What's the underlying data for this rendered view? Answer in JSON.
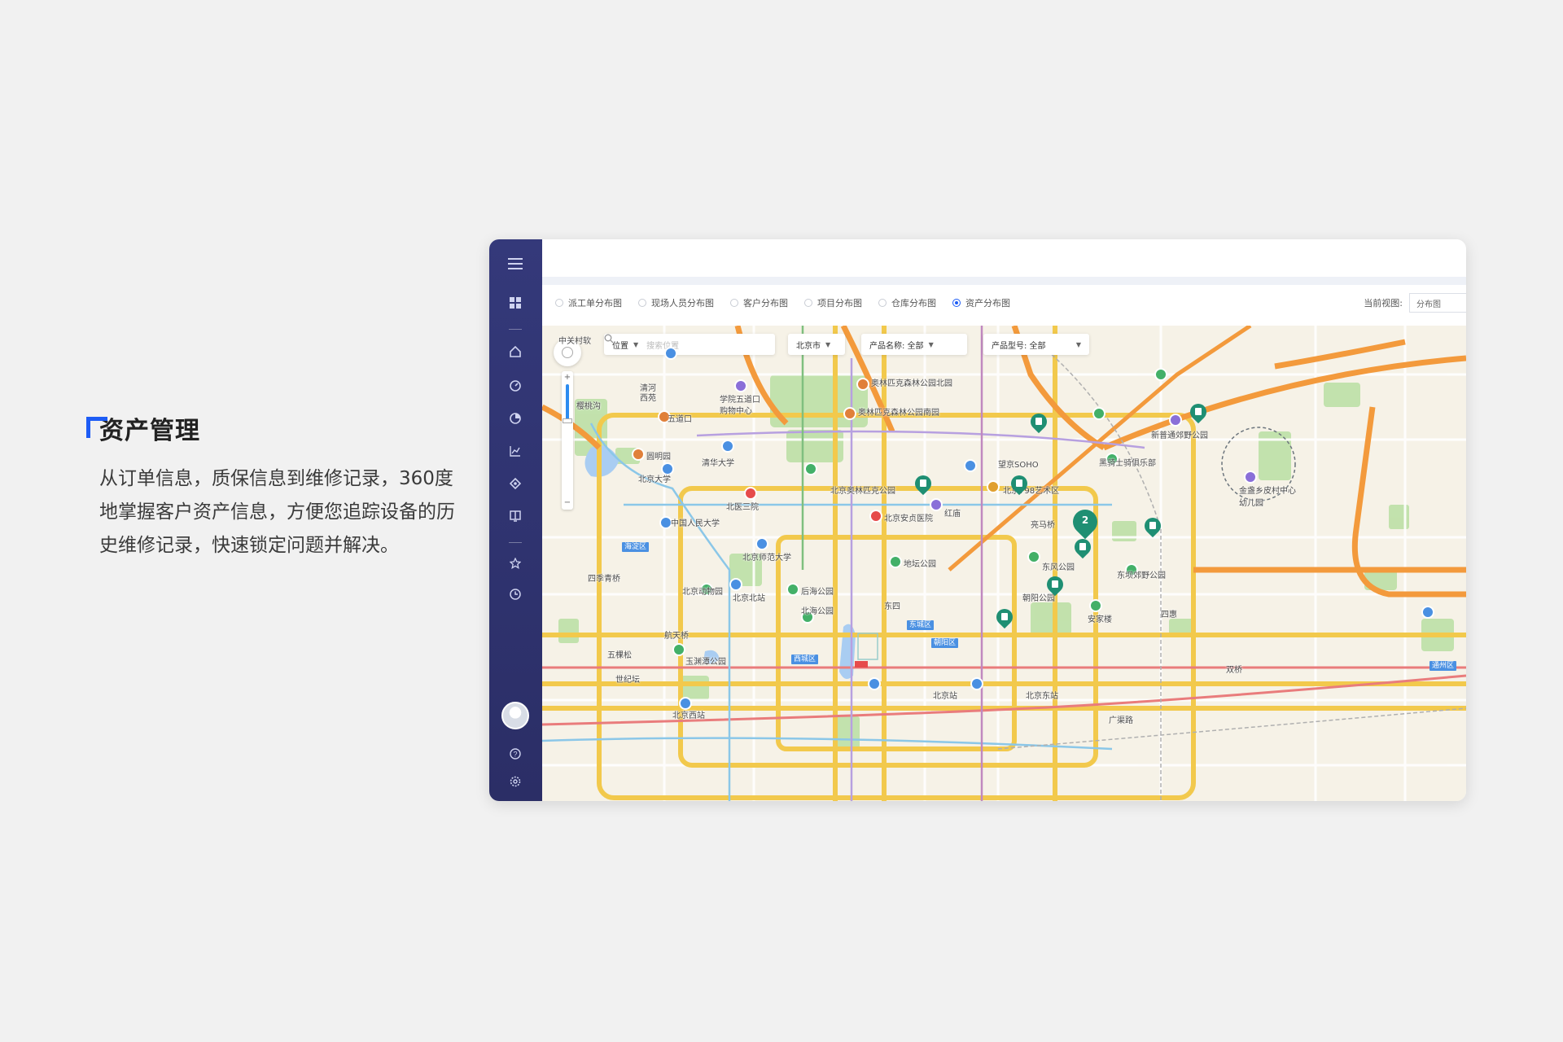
{
  "section": {
    "title": "资产管理",
    "description": "从订单信息，质保信息到维修记录，360度地掌握客户资产信息，方便您追踪设备的历史维修记录，快速锁定问题并解决。"
  },
  "sidebar": {
    "icons": [
      "menu-icon",
      "apps-icon",
      "home-icon",
      "dashboard-icon",
      "pie-chart-icon",
      "line-chart-icon",
      "location-icon",
      "book-icon",
      "star-icon",
      "clock-icon",
      "help-icon",
      "settings-icon"
    ]
  },
  "tabs": [
    {
      "label": "派工单分布图",
      "selected": false
    },
    {
      "label": "现场人员分布图",
      "selected": false
    },
    {
      "label": "客户分布图",
      "selected": false
    },
    {
      "label": "项目分布图",
      "selected": false
    },
    {
      "label": "仓库分布图",
      "selected": false
    },
    {
      "label": "资产分布图",
      "selected": true
    }
  ],
  "current_view": {
    "label": "当前视图:",
    "value": "分布图"
  },
  "filters": {
    "location_label": "位置",
    "search_placeholder": "搜索位置",
    "city": "北京市",
    "product_name": "产品名称: 全部",
    "product_model": "产品型号: 全部"
  },
  "map": {
    "cluster_count": "2",
    "labels": {
      "zhongguancun": "中关村软",
      "xueyuanwudaokou": "学院五道口",
      "zhongguancun2": "购物中心",
      "wudaokou": "五道口",
      "yuanmingyuan": "圆明园",
      "tsinghua": "清华大学",
      "pku": "北京大学",
      "olympic_n": "奥林匹克森林公园北园",
      "olympic_s": "奥林匹克森林公园南园",
      "olympic_park": "北京奥林匹克公园",
      "ruc": "中国人民大学",
      "bnu": "北京师范大学",
      "zoo": "北京动物园",
      "beijing_north": "北京北站",
      "houhai": "后海公园",
      "beihai": "北海公园",
      "ditan": "地坛公园",
      "anzhen": "北京安贞医院",
      "chaoyang_park": "朝阳公园",
      "798": "北京798艺术区",
      "wangjing": "望京SOHO",
      "yuyuantan": "玉渊潭公园",
      "beijing_west": "北京西站",
      "beijing_station": "北京站",
      "beijing_east": "北京东站",
      "haidian": "海淀区",
      "xicheng": "西城区",
      "dongcheng": "东城区",
      "chaoyang": "朝阳区",
      "tongzhou": "通州区",
      "sijiqing": "四季青桥",
      "hangtian": "航天桥",
      "beisanhuan": "北医三院",
      "hongfeng": "红庙",
      "dongfeng": "东风公园",
      "dongba": "东坝郊野公园",
      "jinzhan": "金盏乡皮村中心幼儿园",
      "heiqiao": "黑骑士骑俱乐部",
      "xinpu": "新普通郊野公园",
      "shimen": "清河",
      "anjia": "安家楼",
      "xiyuan": "西苑",
      "guangqu": "广渠路",
      "shuangqiao": "双桥",
      "yingtao": "樱桃沟",
      "dishui": "世纪坛",
      "liangma": "亮马桥",
      "sihui": "四惠",
      "dongsi": "东四",
      "wukesong": "五棵松"
    }
  },
  "colors": {
    "sidebar": "#2f3370",
    "accent": "#1d5cf5",
    "pin": "#1f8f73"
  }
}
